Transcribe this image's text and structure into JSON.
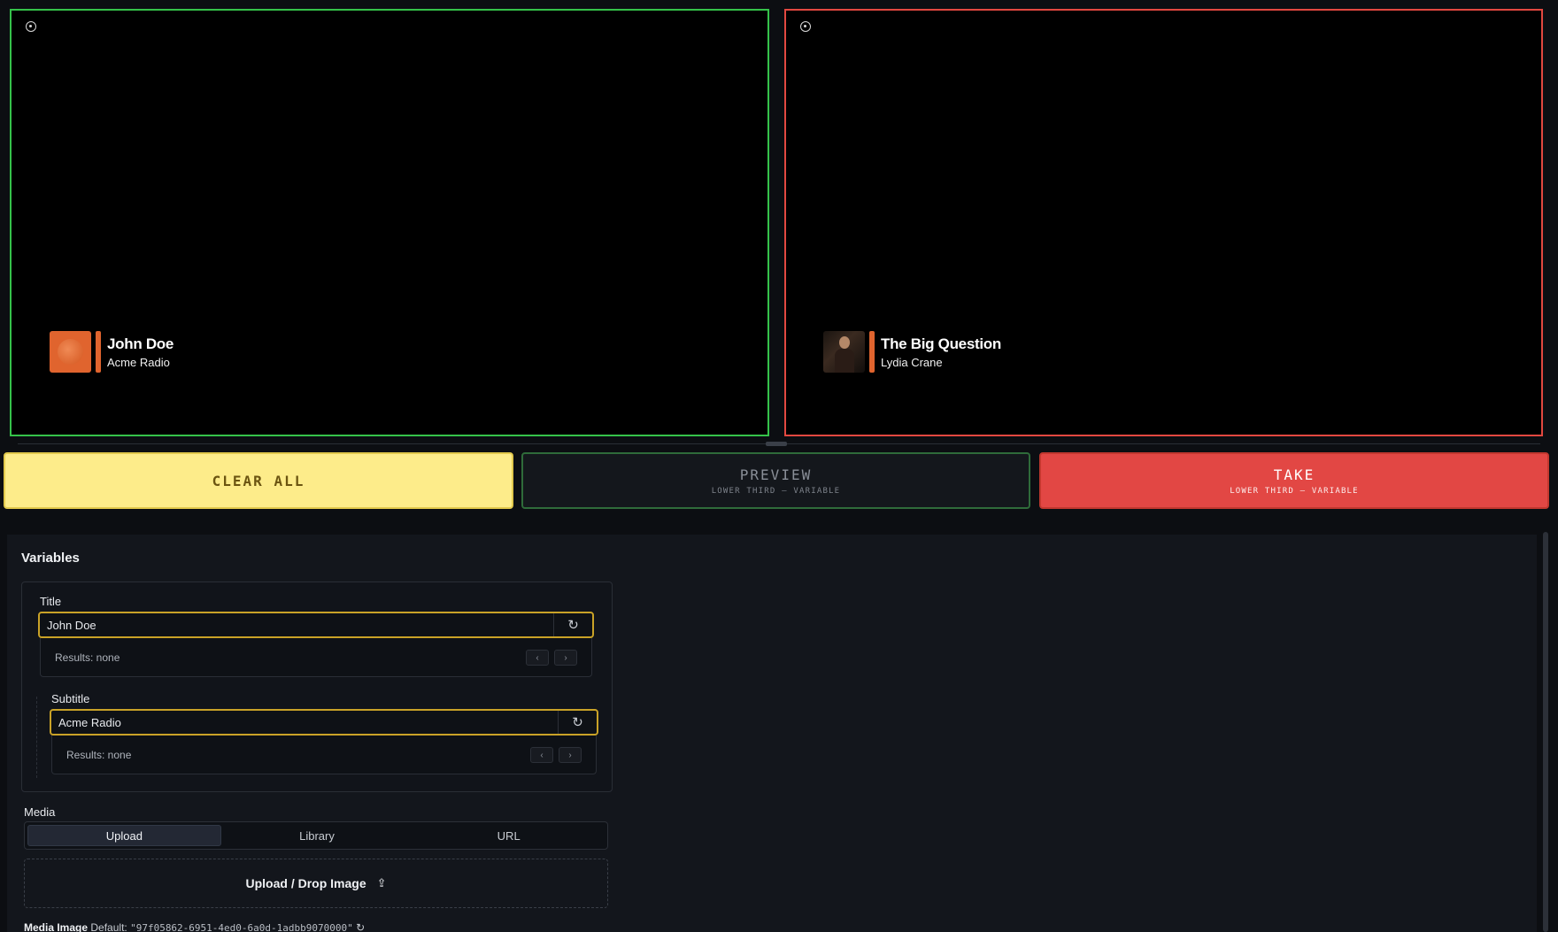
{
  "monitors": {
    "preview": {
      "lower_third": {
        "title": "John Doe",
        "subtitle": "Acme Radio",
        "thumb_icon": "orange-circle-icon"
      }
    },
    "program": {
      "lower_third": {
        "title": "The Big Question",
        "subtitle": "Lydia Crane",
        "thumb_icon": "portrait-photo"
      }
    },
    "border_colors": {
      "preview": "#35c24a",
      "program": "#e24840"
    }
  },
  "actions": {
    "clear": {
      "label": "CLEAR ALL"
    },
    "preview": {
      "label": "PREVIEW",
      "sub": "LOWER THIRD – VARIABLE"
    },
    "take": {
      "label": "TAKE",
      "sub": "LOWER THIRD – VARIABLE"
    }
  },
  "variables": {
    "heading": "Variables",
    "title": {
      "label": "Title",
      "value": "John Doe",
      "results": "Results: none",
      "prev": "‹",
      "next": "›"
    },
    "subtitle": {
      "label": "Subtitle",
      "value": "Acme Radio",
      "results": "Results: none",
      "prev": "‹",
      "next": "›"
    }
  },
  "media": {
    "label": "Media",
    "tabs": [
      {
        "label": "Upload",
        "active": true
      },
      {
        "label": "Library",
        "active": false
      },
      {
        "label": "URL",
        "active": false
      }
    ],
    "dropzone_label": "Upload / Drop Image",
    "default": {
      "name": "Media Image",
      "prefix": "Default:",
      "value": "\"97f05862-6951-4ed0-6a0d-1adbb9070000\""
    }
  },
  "colors": {
    "accent": "#c9a227",
    "take": "#e24744",
    "clear": "#fdec8a"
  }
}
